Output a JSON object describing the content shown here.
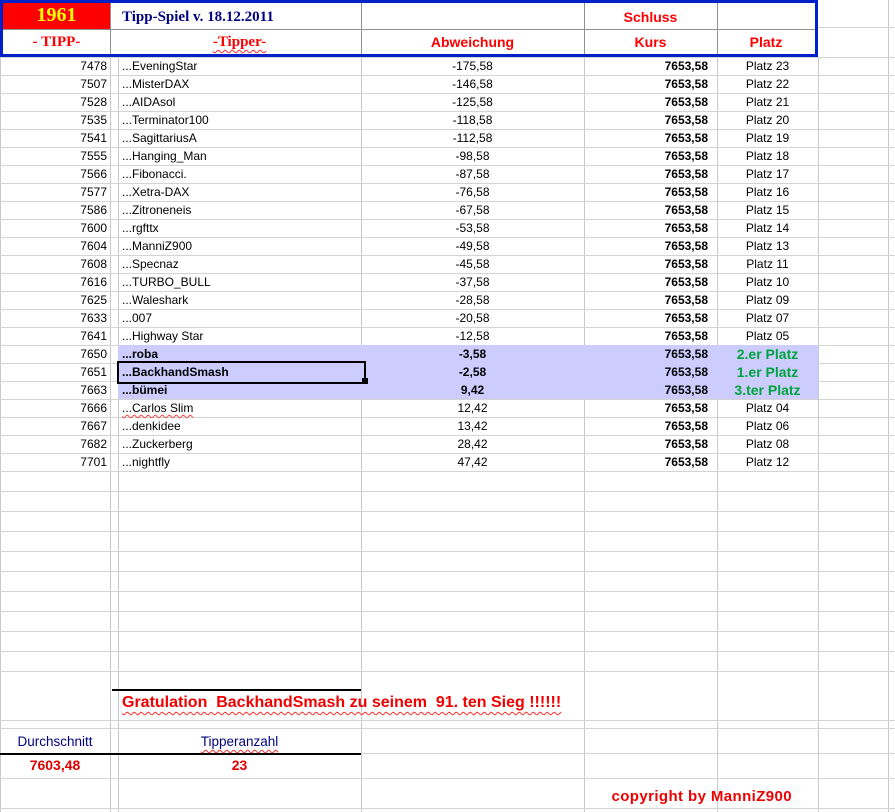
{
  "colors": {
    "accent_red": "#ff0000",
    "title_navy": "#000080",
    "winner_green": "#00a43c",
    "highlight_lavender": "#ccccff",
    "border_blue": "#0020c8",
    "tipp_cell_bg": "#ff0000",
    "tipp_cell_text": "#ffff00"
  },
  "header": {
    "tipp_number": "1961",
    "title": "Tipp-Spiel v. 18.12.2011",
    "col_tipp": "- TIPP-",
    "col_tipper": "-Tipper-",
    "col_abweichung": "Abweichung",
    "col_schluss": "Schluss",
    "col_kurs": "Kurs",
    "col_platz": "Platz"
  },
  "table": {
    "rows": [
      {
        "tipp": "7478",
        "tipper": "...EveningStar",
        "abw": "-175,58",
        "kurs": "7653,58",
        "platz": "Platz 23"
      },
      {
        "tipp": "7507",
        "tipper": "...MisterDAX",
        "abw": "-146,58",
        "kurs": "7653,58",
        "platz": "Platz 22"
      },
      {
        "tipp": "7528",
        "tipper": "...AIDAsol",
        "abw": "-125,58",
        "kurs": "7653,58",
        "platz": "Platz 21"
      },
      {
        "tipp": "7535",
        "tipper": "...Terminator100",
        "abw": "-118,58",
        "kurs": "7653,58",
        "platz": "Platz 20"
      },
      {
        "tipp": "7541",
        "tipper": "...SagittariusA",
        "abw": "-112,58",
        "kurs": "7653,58",
        "platz": "Platz 19"
      },
      {
        "tipp": "7555",
        "tipper": "...Hanging_Man",
        "abw": "-98,58",
        "kurs": "7653,58",
        "platz": "Platz 18"
      },
      {
        "tipp": "7566",
        "tipper": "...Fibonacci.",
        "abw": "-87,58",
        "kurs": "7653,58",
        "platz": "Platz 17"
      },
      {
        "tipp": "7577",
        "tipper": "...Xetra-DAX",
        "abw": "-76,58",
        "kurs": "7653,58",
        "platz": "Platz 16"
      },
      {
        "tipp": "7586",
        "tipper": "...Zitroneneis",
        "abw": "-67,58",
        "kurs": "7653,58",
        "platz": "Platz 15"
      },
      {
        "tipp": "7600",
        "tipper": "...rgfttx",
        "abw": "-53,58",
        "kurs": "7653,58",
        "platz": "Platz 14"
      },
      {
        "tipp": "7604",
        "tipper": "...ManniZ900",
        "abw": "-49,58",
        "kurs": "7653,58",
        "platz": "Platz 13"
      },
      {
        "tipp": "7608",
        "tipper": "...Specnaz",
        "abw": "-45,58",
        "kurs": "7653,58",
        "platz": "Platz 11"
      },
      {
        "tipp": "7616",
        "tipper": "...TURBO_BULL",
        "abw": "-37,58",
        "kurs": "7653,58",
        "platz": "Platz 10"
      },
      {
        "tipp": "7625",
        "tipper": "...Waleshark",
        "abw": "-28,58",
        "kurs": "7653,58",
        "platz": "Platz 09"
      },
      {
        "tipp": "7633",
        "tipper": "...007",
        "abw": "-20,58",
        "kurs": "7653,58",
        "platz": "Platz 07"
      },
      {
        "tipp": "7641",
        "tipper": "...Highway Star",
        "abw": "-12,58",
        "kurs": "7653,58",
        "platz": "Platz 05"
      },
      {
        "tipp": "7650",
        "tipper": "...roba",
        "abw": "-3,58",
        "kurs": "7653,58",
        "platz": "2.er Platz",
        "hl": true,
        "green": true
      },
      {
        "tipp": "7651",
        "tipper": "...BackhandSmash",
        "abw": "-2,58",
        "kurs": "7653,58",
        "platz": "1.er Platz",
        "hl": true,
        "green": true,
        "sel": true
      },
      {
        "tipp": "7663",
        "tipper": "...bümei",
        "abw": "9,42",
        "kurs": "7653,58",
        "platz": "3.ter Platz",
        "hl": true,
        "green": true
      },
      {
        "tipp": "7666",
        "tipper": "...Carlos Slim",
        "abw": "12,42",
        "kurs": "7653,58",
        "platz": "Platz 04",
        "wavy": true
      },
      {
        "tipp": "7667",
        "tipper": "...denkidee",
        "abw": "13,42",
        "kurs": "7653,58",
        "platz": "Platz 06"
      },
      {
        "tipp": "7682",
        "tipper": "...Zuckerberg",
        "abw": "28,42",
        "kurs": "7653,58",
        "platz": "Platz 08"
      },
      {
        "tipp": "7701",
        "tipper": "...nightfly",
        "abw": "47,42",
        "kurs": "7653,58",
        "platz": "Platz 12"
      }
    ]
  },
  "footer": {
    "congrats": "Gratulation  BackhandSmash zu seinem  91. ten Sieg !!!!!!",
    "average_label": "Durchschnitt",
    "average_value": "7603,48",
    "count_label": "Tipperanzahl",
    "count_value": "23",
    "copyright": "copyright by ManniZ900"
  }
}
